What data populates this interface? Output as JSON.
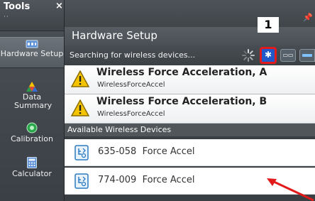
{
  "sidebar": {
    "title": "Tools",
    "close": "×",
    "grip": "··",
    "items": [
      {
        "label": "Hardware Setup",
        "icon": "hardware-icon"
      },
      {
        "label": "Data Summary",
        "icon": "data-summary-icon"
      },
      {
        "label": "Calibration",
        "icon": "calibration-icon"
      },
      {
        "label": "Calculator",
        "icon": "calculator-icon"
      }
    ]
  },
  "panel": {
    "title": "Hardware Setup",
    "status": "Searching for wireless devices...",
    "bluetooth_glyph": "✱",
    "usb_glyph": "▭▭",
    "callout": "1"
  },
  "connected_sensors": [
    {
      "name": "Wireless Force Acceleration, A",
      "type": "WirelessForceAccel"
    },
    {
      "name": "Wireless Force Acceleration, B",
      "type": "WirelessForceAccel"
    }
  ],
  "available_header": "Available Wireless Devices",
  "available_devices": [
    {
      "name": "635-058  Force Accel"
    },
    {
      "name": "774-009  Force Accel"
    }
  ],
  "colors": {
    "accent_red": "#e31a1a",
    "bluetooth_blue": "#2258c8",
    "warning_yellow": "#f5c400"
  }
}
